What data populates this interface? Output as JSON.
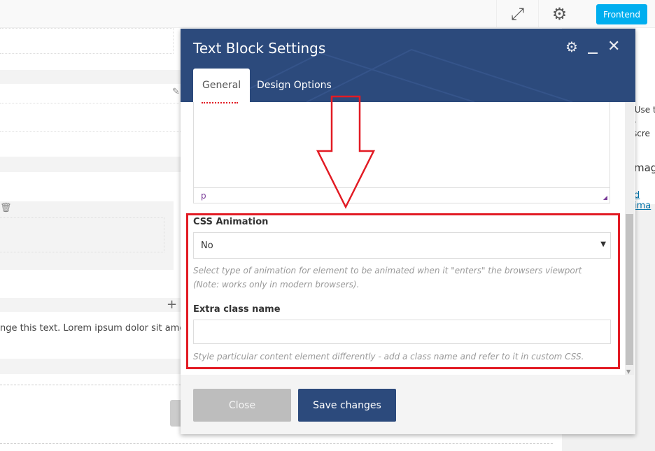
{
  "toolbar": {
    "fullscreen_icon": "fullscreen-icon",
    "settings_icon": "gear-icon",
    "frontend_label": "Frontend",
    "frontend_color": "#00aeef"
  },
  "background": {
    "lorem_text": "nge this text. Lorem ipsum dolor sit amet, c",
    "right_text_1": "Use t",
    "right_text_2": "r scre",
    "right_heading": "mage",
    "right_link": "d ima"
  },
  "modal": {
    "title": "Text Block Settings",
    "header_color": "#2c4a7c",
    "tabs": [
      {
        "label": "General",
        "active": true
      },
      {
        "label": "Design Options",
        "active": false
      }
    ],
    "editor_status": "p",
    "highlight_color": "#e21b24",
    "css_animation": {
      "label": "CSS Animation",
      "value": "No",
      "help": "Select type of animation for element to be animated when it \"enters\" the browsers viewport (Note: works only in modern browsers)."
    },
    "extra_class": {
      "label": "Extra class name",
      "value": "",
      "help": "Style particular content element differently - add a class name and refer to it in custom CSS."
    },
    "close_label": "Close",
    "save_label": "Save changes"
  }
}
